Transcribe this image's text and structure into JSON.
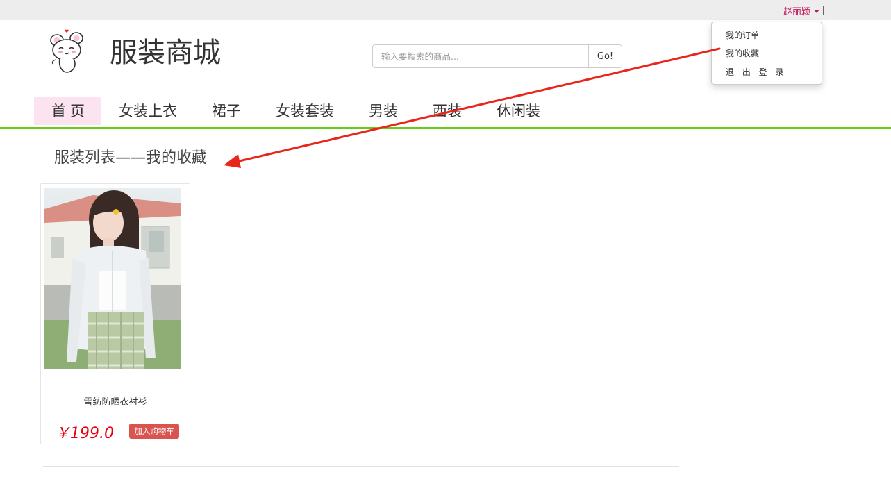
{
  "user": {
    "name": "赵丽颖"
  },
  "user_menu": {
    "items": [
      "我的订单",
      "我的收藏"
    ],
    "logout": "退 出 登 录"
  },
  "brand": {
    "title": "服装商城",
    "logo_icon": "cartoon-mouse-logo"
  },
  "search": {
    "placeholder": "输入要搜索的商品...",
    "button": "Go!"
  },
  "nav": {
    "items": [
      "首页",
      "女装上衣",
      "裙子",
      "女装套装",
      "男装",
      "西装",
      "休闲装"
    ],
    "active_index": 0,
    "accent": "#66cc1a",
    "active_bg": "#fbe4ef"
  },
  "section": {
    "title": "服装列表——我的收藏"
  },
  "products": [
    {
      "name": "雪纺防晒衣衬衫",
      "price": "￥199.0",
      "cart_button": "加入购物车"
    }
  ],
  "annotation": {
    "type": "red-arrow",
    "from": "我的收藏",
    "to": "服装列表——我的收藏",
    "color": "#e8261c"
  }
}
